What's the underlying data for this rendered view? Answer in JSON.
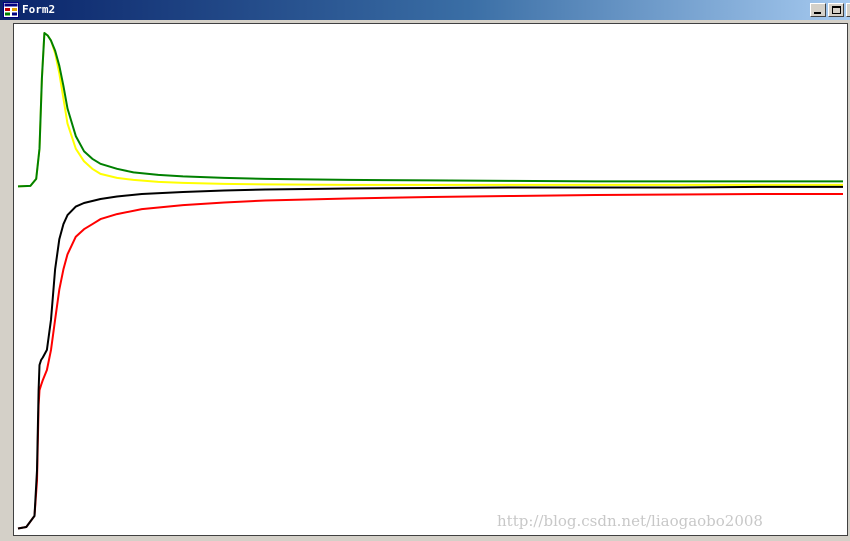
{
  "window": {
    "title": "Form2",
    "buttons": {
      "minimize": "minimize",
      "maximize": "maximize",
      "close": "X"
    }
  },
  "watermark": "http://blog.csdn.net/liaogaobo2008",
  "colors": {
    "titlebar_start": "#0a246a",
    "titlebar_end": "#a6caf0",
    "window_face": "#d4d0c8",
    "plot_background": "#ffffff"
  },
  "chart_data": {
    "type": "line",
    "title": "",
    "xlabel": "",
    "ylabel": "",
    "grid": false,
    "legend": "none",
    "xlim": [
      0,
      100
    ],
    "ylim": [
      0,
      100
    ],
    "series": [
      {
        "color": "#ffff00",
        "x": [
          0,
          1.5,
          2.2,
          2.6,
          2.9,
          3.2,
          3.6,
          4.0,
          4.5,
          5.0,
          5.5,
          6.0,
          7.0,
          8.0,
          9.0,
          10.0,
          12.0,
          14.0,
          17.0,
          20.0,
          25.0,
          30.0,
          40.0,
          50.0,
          60.0,
          70.0,
          80.0,
          90.0,
          100.0
        ],
        "y": [
          68.5,
          68.6,
          70.0,
          76.0,
          90.0,
          99.0,
          98.5,
          97.5,
          95.0,
          91.0,
          86.0,
          81.0,
          76.0,
          73.5,
          72.0,
          71.0,
          70.2,
          69.8,
          69.4,
          69.2,
          69.0,
          68.9,
          68.8,
          68.8,
          68.8,
          68.8,
          68.8,
          68.8,
          68.8
        ]
      },
      {
        "color": "#008000",
        "x": [
          0,
          1.5,
          2.2,
          2.6,
          2.9,
          3.2,
          3.6,
          4.0,
          4.5,
          5.0,
          5.5,
          6.0,
          7.0,
          8.0,
          9.0,
          10.0,
          12.0,
          14.0,
          17.0,
          20.0,
          25.0,
          30.0,
          40.0,
          50.0,
          60.0,
          70.0,
          80.0,
          90.0,
          100.0
        ],
        "y": [
          68.5,
          68.6,
          70.0,
          76.0,
          90.0,
          99.0,
          98.5,
          97.5,
          95.5,
          92.5,
          88.5,
          84.0,
          78.5,
          75.5,
          74.0,
          73.0,
          72.0,
          71.3,
          70.8,
          70.5,
          70.2,
          70.0,
          69.8,
          69.7,
          69.6,
          69.5,
          69.5,
          69.5,
          69.5
        ]
      },
      {
        "color": "#ff0000",
        "x": [
          0,
          1.0,
          2.0,
          2.3,
          2.5,
          2.6,
          2.8,
          3.0,
          3.5,
          4.0,
          4.5,
          5.0,
          5.5,
          6.0,
          7.0,
          8.0,
          9.0,
          10.0,
          12.0,
          15.0,
          20.0,
          25.0,
          30.0,
          40.0,
          50.0,
          60.0,
          70.0,
          80.0,
          90.0,
          100.0
        ],
        "y": [
          0.5,
          0.8,
          3.0,
          10.0,
          25.0,
          28.0,
          29.0,
          30.0,
          32.0,
          36.0,
          42.0,
          48.0,
          52.0,
          55.0,
          58.5,
          60.0,
          61.0,
          62.0,
          63.0,
          64.0,
          64.8,
          65.3,
          65.7,
          66.1,
          66.4,
          66.6,
          66.8,
          66.9,
          67.0,
          67.0
        ]
      },
      {
        "color": "#000000",
        "x": [
          0,
          1.0,
          2.0,
          2.3,
          2.5,
          2.6,
          2.8,
          3.0,
          3.5,
          4.0,
          4.5,
          5.0,
          5.5,
          6.0,
          7.0,
          8.0,
          9.0,
          10.0,
          12.0,
          15.0,
          20.0,
          25.0,
          30.0,
          40.0,
          50.0,
          60.0,
          70.0,
          80.0,
          90.0,
          100.0
        ],
        "y": [
          0.5,
          0.8,
          3.0,
          12.0,
          28.0,
          33.0,
          34.0,
          34.5,
          36.0,
          42.0,
          52.0,
          58.0,
          61.0,
          62.8,
          64.5,
          65.2,
          65.6,
          66.0,
          66.5,
          67.0,
          67.4,
          67.7,
          67.9,
          68.1,
          68.2,
          68.3,
          68.3,
          68.3,
          68.4,
          68.4
        ]
      }
    ]
  }
}
